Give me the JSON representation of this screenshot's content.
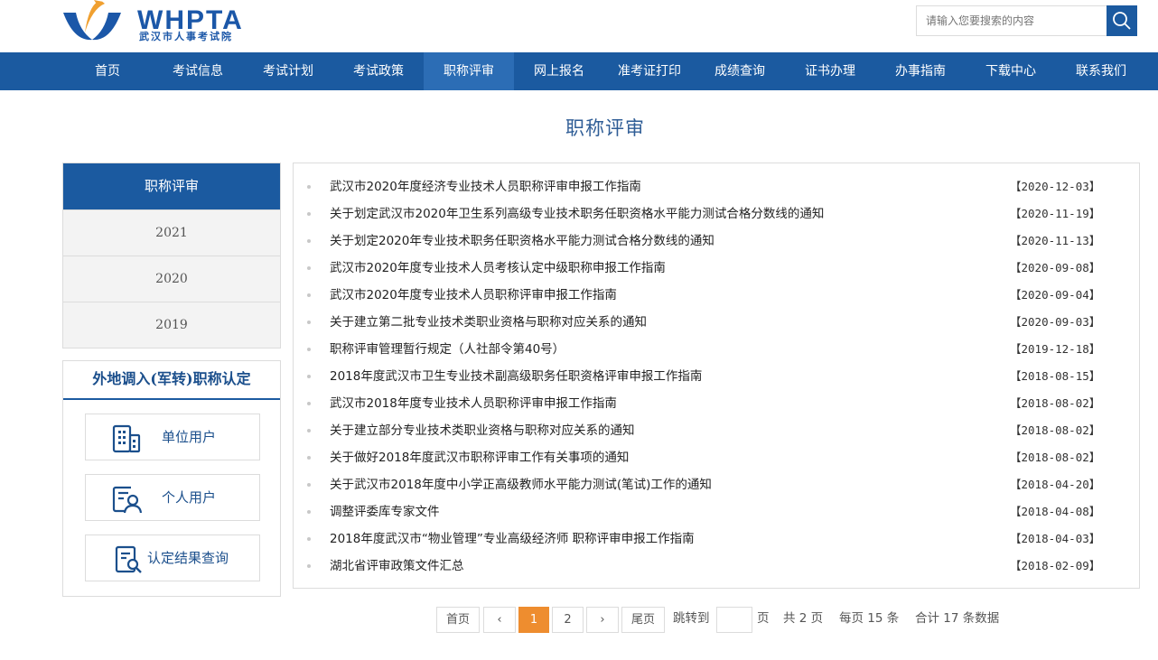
{
  "header": {
    "logo_text": "WHPTA",
    "logo_sub": "武汉市人事考试院",
    "search_placeholder": "请输入您要搜索的内容"
  },
  "nav": [
    {
      "label": "首页"
    },
    {
      "label": "考试信息"
    },
    {
      "label": "考试计划"
    },
    {
      "label": "考试政策"
    },
    {
      "label": "职称评审",
      "active": true
    },
    {
      "label": "网上报名"
    },
    {
      "label": "准考证打印"
    },
    {
      "label": "成绩查询"
    },
    {
      "label": "证书办理"
    },
    {
      "label": "办事指南"
    },
    {
      "label": "下载中心"
    },
    {
      "label": "联系我们"
    }
  ],
  "page_title": "职称评审",
  "sidebar": {
    "head": "职称评审",
    "years": [
      "2021",
      "2020",
      "2019"
    ],
    "transfer_title": "外地调入(军转)职称认定",
    "buttons": [
      "单位用户",
      "个人用户",
      "认定结果查询"
    ]
  },
  "list": [
    {
      "title": "武汉市2020年度经济专业技术人员职称评审申报工作指南",
      "date": "【2020-12-03】"
    },
    {
      "title": "关于划定武汉市2020年卫生系列高级专业技术职务任职资格水平能力测试合格分数线的通知",
      "date": "【2020-11-19】"
    },
    {
      "title": "关于划定2020年专业技术职务任职资格水平能力测试合格分数线的通知",
      "date": "【2020-11-13】"
    },
    {
      "title": "武汉市2020年度专业技术人员考核认定中级职称申报工作指南",
      "date": "【2020-09-08】"
    },
    {
      "title": "武汉市2020年度专业技术人员职称评审申报工作指南",
      "date": "【2020-09-04】"
    },
    {
      "title": "关于建立第二批专业技术类职业资格与职称对应关系的通知",
      "date": "【2020-09-03】"
    },
    {
      "title": "职称评审管理暂行规定（人社部令第40号）",
      "date": "【2019-12-18】"
    },
    {
      "title": "2018年度武汉市卫生专业技术副高级职务任职资格评审申报工作指南",
      "date": "【2018-08-15】"
    },
    {
      "title": "武汉市2018年度专业技术人员职称评审申报工作指南",
      "date": "【2018-08-02】"
    },
    {
      "title": "关于建立部分专业技术类职业资格与职称对应关系的通知",
      "date": "【2018-08-02】"
    },
    {
      "title": "关于做好2018年度武汉市职称评审工作有关事项的通知",
      "date": "【2018-08-02】"
    },
    {
      "title": "关于武汉市2018年度中小学正高级教师水平能力测试(笔试)工作的通知",
      "date": "【2018-04-20】"
    },
    {
      "title": "调整评委库专家文件",
      "date": "【2018-04-08】"
    },
    {
      "title": "2018年度武汉市“物业管理”专业高级经济师 职称评审申报工作指南",
      "date": "【2018-04-03】"
    },
    {
      "title": "湖北省评审政策文件汇总",
      "date": "【2018-02-09】"
    }
  ],
  "pager": {
    "first": "首页",
    "prev": "‹",
    "pages": [
      "1",
      "2"
    ],
    "next": "›",
    "last": "尾页",
    "jump_label": "跳转到",
    "page_unit": "页",
    "total_pages": "共 2 页",
    "per_page": "每页 15 条",
    "total": "合计 17 条数据"
  }
}
